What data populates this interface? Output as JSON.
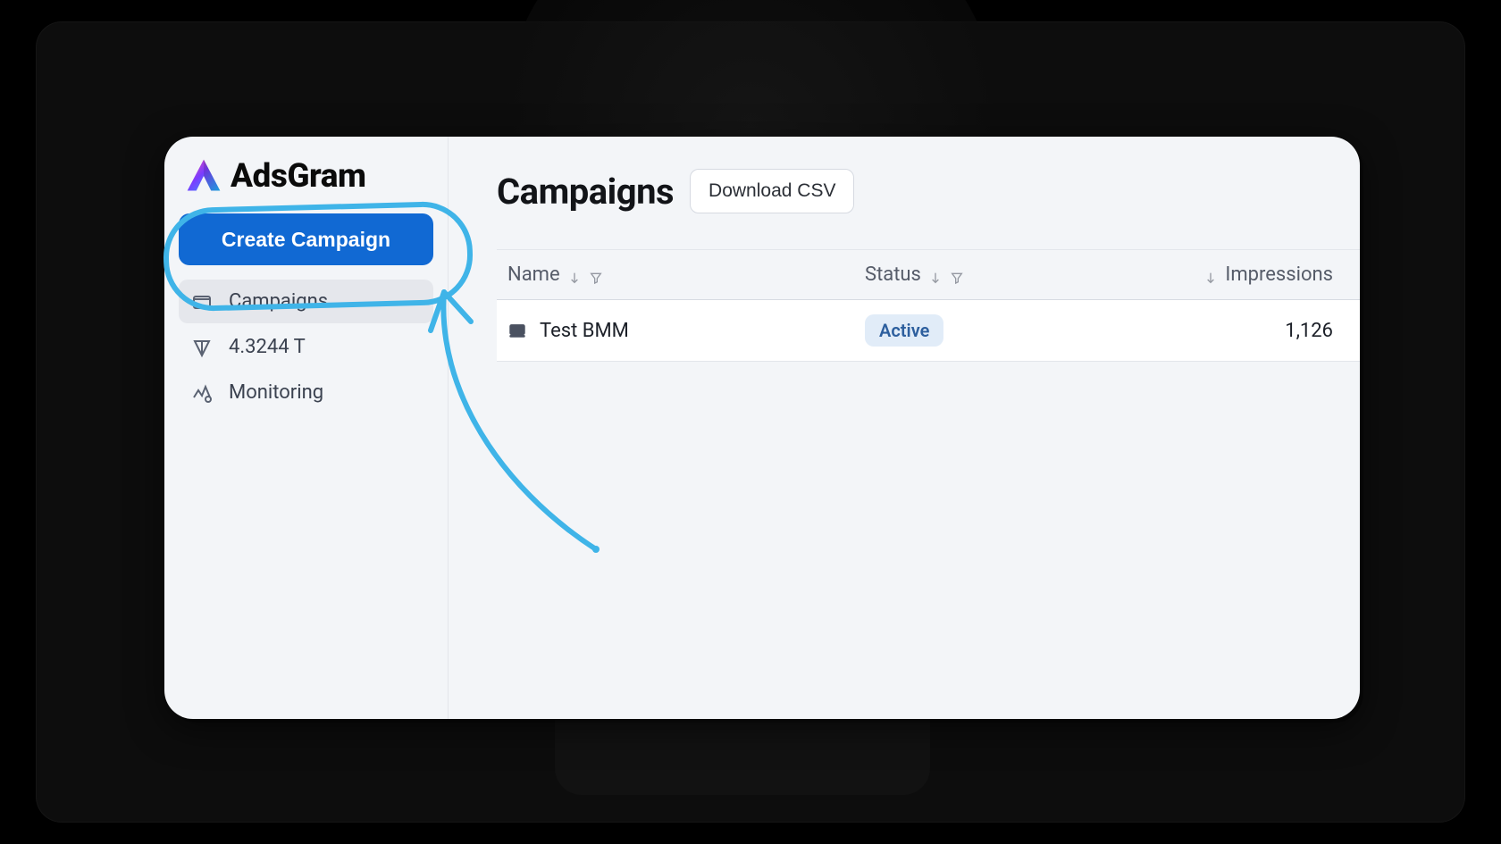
{
  "brand": {
    "name": "AdsGram"
  },
  "sidebar": {
    "create_label": "Create Campaign",
    "items": [
      {
        "label": "Campaigns"
      },
      {
        "label": "4.3244 T"
      },
      {
        "label": "Monitoring"
      }
    ]
  },
  "main": {
    "title": "Campaigns",
    "download_csv_label": "Download CSV"
  },
  "table": {
    "columns": {
      "name": "Name",
      "status": "Status",
      "impressions": "Impressions"
    },
    "rows": [
      {
        "name": "Test BMM",
        "status": "Active",
        "impressions": "1,126"
      }
    ]
  },
  "colors": {
    "primary": "#1169d3",
    "annotation": "#3fb4e8",
    "badge_bg": "#e1ecf8",
    "badge_fg": "#2d5f9e"
  }
}
